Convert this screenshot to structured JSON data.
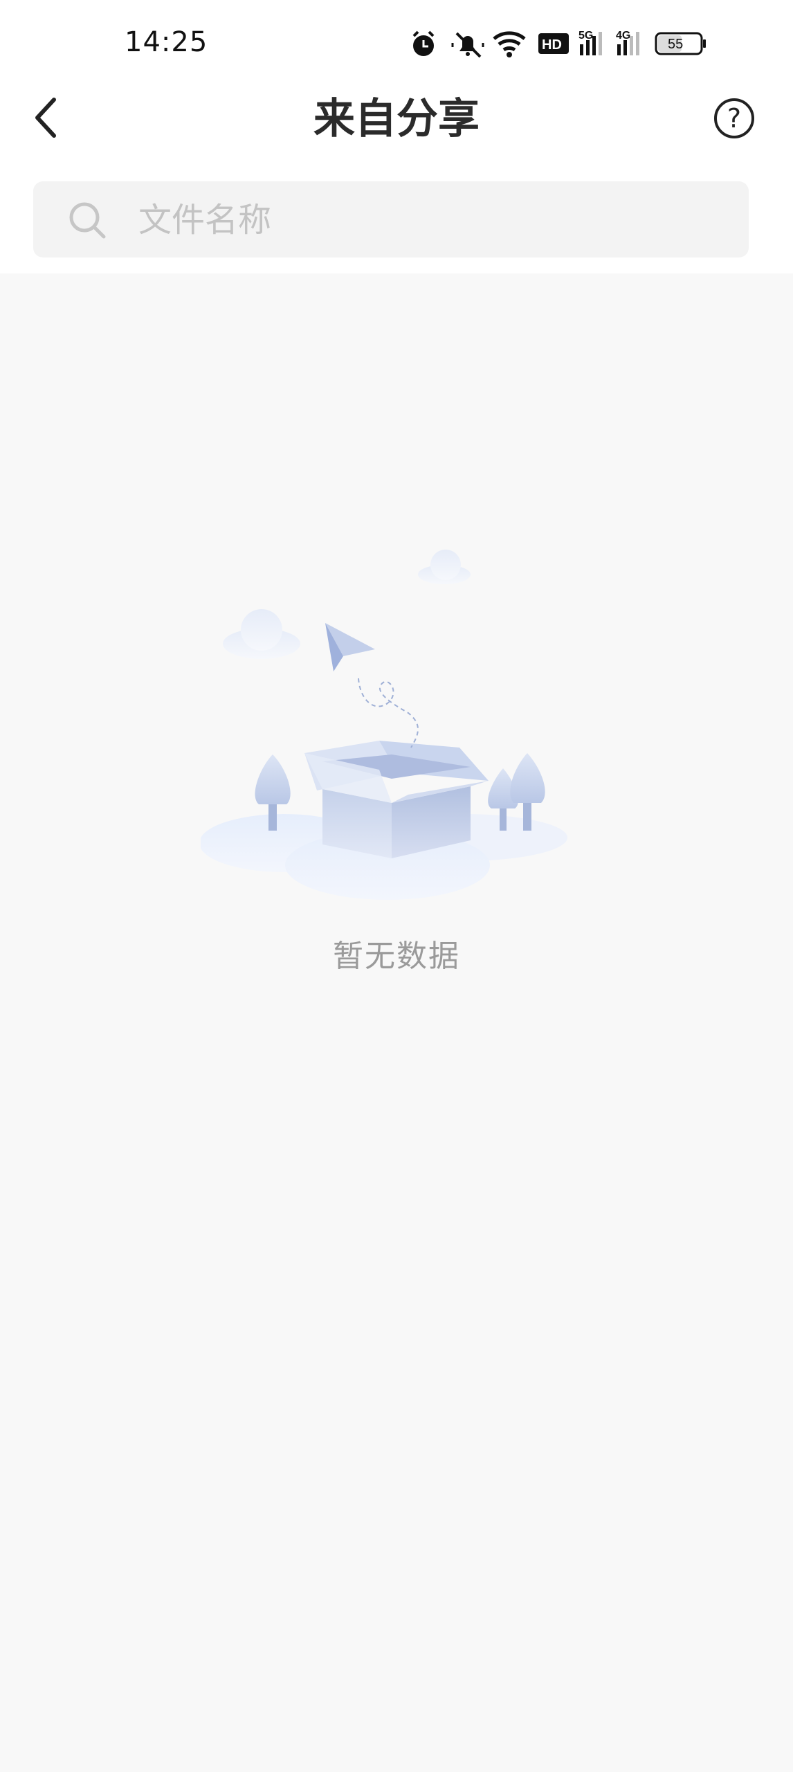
{
  "status_bar": {
    "time": "14:25",
    "battery": "55",
    "network_labels": [
      "HD",
      "5G",
      "4G"
    ]
  },
  "nav": {
    "title": "来自分享",
    "help_label": "?"
  },
  "search": {
    "placeholder": "文件名称",
    "value": ""
  },
  "empty_state": {
    "message": "暂无数据"
  },
  "colors": {
    "background": "#f8f8f8",
    "header_background": "#ffffff",
    "search_background": "#f3f3f3",
    "placeholder": "#c3c3c3",
    "empty_text": "#9a9a9a"
  }
}
